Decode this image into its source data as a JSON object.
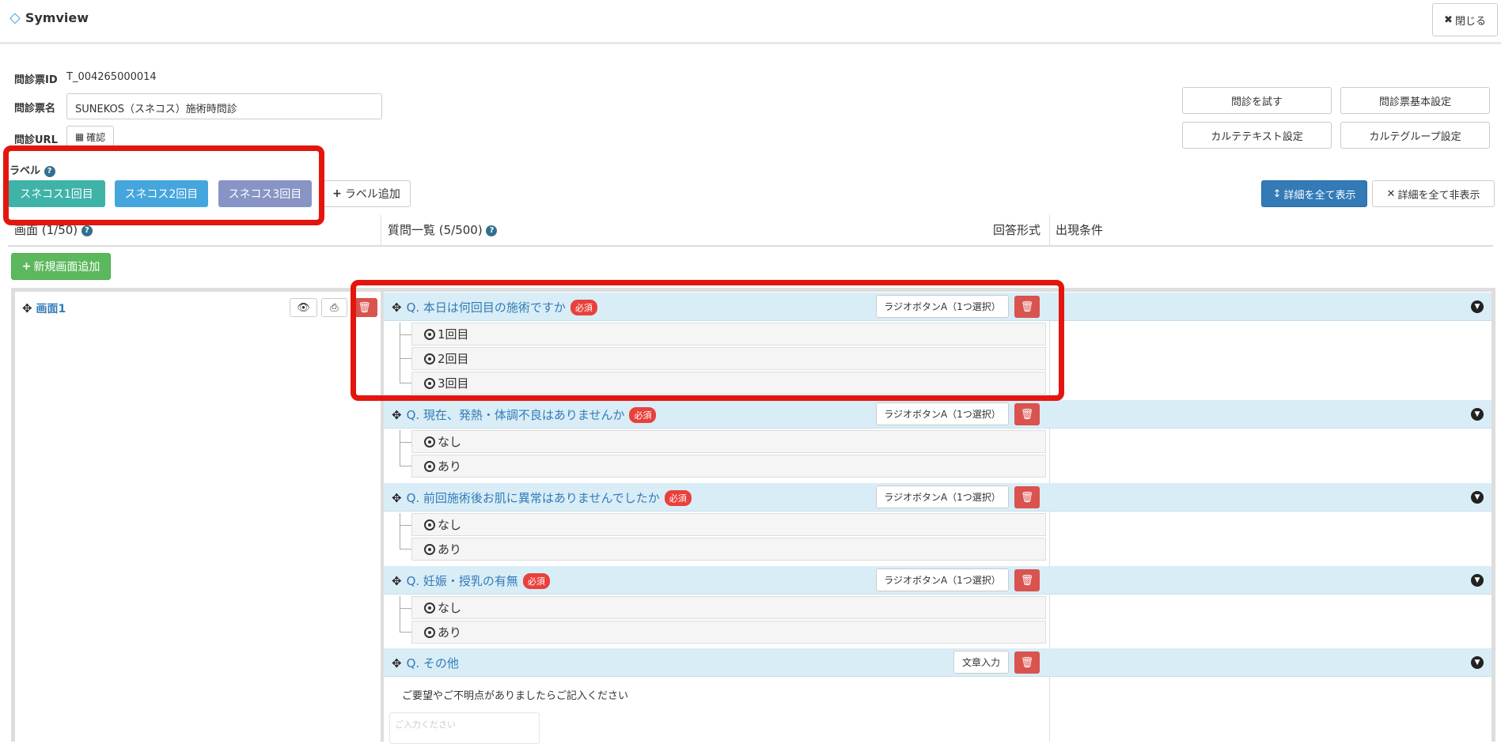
{
  "app": {
    "name": "Symview",
    "close_label": "閉じる"
  },
  "form": {
    "id_label": "問診票ID",
    "id_value": "T_004265000014",
    "name_label": "問診票名",
    "name_value": "SUNEKOS（スネコス）施術時問診",
    "url_label": "問診URL",
    "url_button": "確認"
  },
  "labels": {
    "title": "ラベル",
    "items": [
      {
        "text": "スネコス1回目",
        "color": "#3fb3a8"
      },
      {
        "text": "スネコス2回目",
        "color": "#45a6dd"
      },
      {
        "text": "スネコス3回目",
        "color": "#8794c5"
      }
    ],
    "add_label": "ラベル追加"
  },
  "actions": {
    "try": "問診を試す",
    "basic": "問診票基本設定",
    "karte_text": "カルテテキスト設定",
    "karte_group": "カルテグループ設定",
    "expand_all": "詳細を全て表示",
    "collapse_all": "詳細を全て非表示"
  },
  "columns": {
    "screens": "画面 (1/50)",
    "questions": "質問一覧 (5/500)",
    "answer_type": "回答形式",
    "conditions": "出現条件"
  },
  "add_screen": "新規画面追加",
  "screens": [
    {
      "name": "画面1"
    }
  ],
  "questions": [
    {
      "title": "Q. 本日は何回目の施術ですか",
      "required": "必須",
      "type": "ラジオボタンA（1つ選択）",
      "options": [
        "1回目",
        "2回目",
        "3回目"
      ]
    },
    {
      "title": "Q. 現在、発熱・体調不良はありませんか",
      "required": "必須",
      "type": "ラジオボタンA（1つ選択）",
      "options": [
        "なし",
        "あり"
      ]
    },
    {
      "title": "Q. 前回施術後お肌に異常はありませんでしたか",
      "required": "必須",
      "type": "ラジオボタンA（1つ選択）",
      "options": [
        "なし",
        "あり"
      ]
    },
    {
      "title": "Q. 妊娠・授乳の有無",
      "required": "必須",
      "type": "ラジオボタンA（1つ選択）",
      "options": [
        "なし",
        "あり"
      ]
    },
    {
      "title": "Q. その他",
      "type": "文章入力",
      "description": "ご要望やご不明点がありましたらご記入ください",
      "placeholder": "ご入力ください"
    }
  ]
}
